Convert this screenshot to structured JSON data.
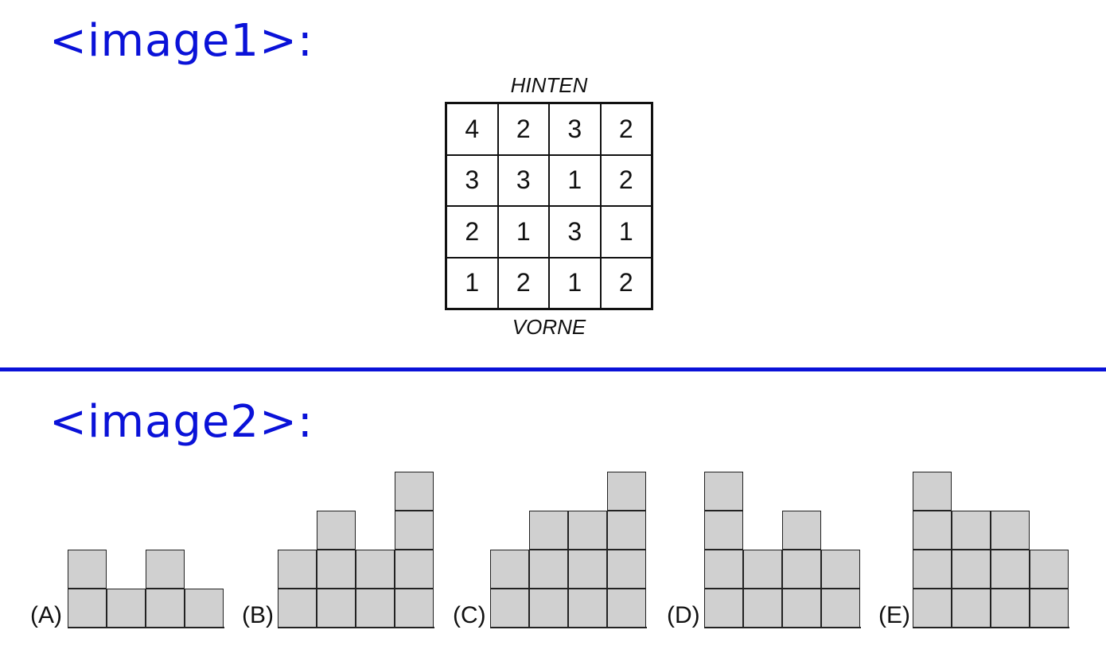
{
  "image1_label": "<image1>:",
  "image2_label": "<image2>:",
  "grid": {
    "top_label": "HINTEN",
    "bottom_label": "VORNE",
    "rows": [
      [
        "4",
        "2",
        "3",
        "2"
      ],
      [
        "3",
        "3",
        "1",
        "2"
      ],
      [
        "2",
        "1",
        "3",
        "1"
      ],
      [
        "1",
        "2",
        "1",
        "2"
      ]
    ]
  },
  "options": [
    {
      "label": "(A)",
      "column_heights": [
        2,
        1,
        2,
        1
      ]
    },
    {
      "label": "(B)",
      "column_heights": [
        2,
        3,
        2,
        4
      ]
    },
    {
      "label": "(C)",
      "column_heights": [
        2,
        3,
        3,
        4
      ]
    },
    {
      "label": "(D)",
      "column_heights": [
        4,
        2,
        3,
        2
      ]
    },
    {
      "label": "(E)",
      "column_heights": [
        4,
        3,
        3,
        2
      ]
    }
  ],
  "colors": {
    "accent": "#0a12d8",
    "block_fill": "#d0d0d0"
  }
}
